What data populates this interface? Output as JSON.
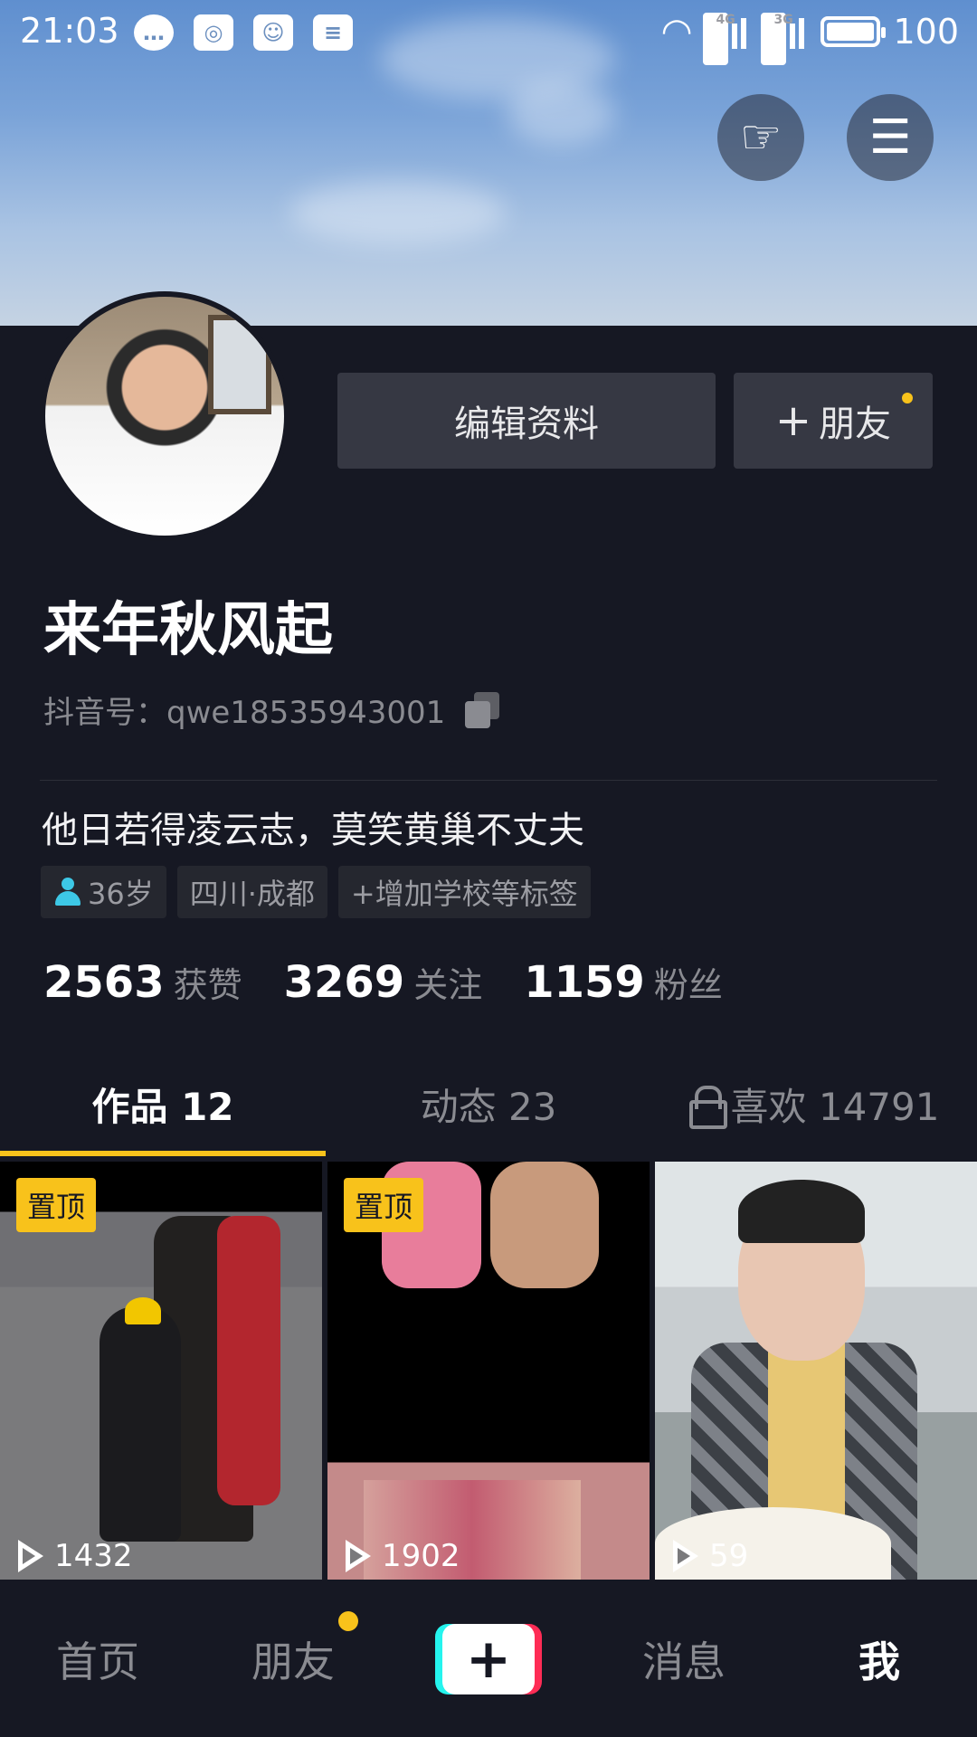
{
  "status_bar": {
    "time": "21:03",
    "battery_level": "100",
    "network_a": "4G",
    "network_b": "3G",
    "icons": [
      "message-icon",
      "weibo-icon",
      "qq-icon",
      "news-icon",
      "wifi-icon",
      "signal-icon",
      "battery-icon"
    ]
  },
  "header": {
    "icons": [
      "hand-pointer-icon",
      "menu-icon"
    ]
  },
  "profile": {
    "edit_label": "编辑资料",
    "add_friend_label": "朋友",
    "add_friend_plus": "+",
    "name": "来年秋风起",
    "uid_label": "抖音号：",
    "uid": "qwe18535943001",
    "bio": "他日若得凌云志，莫笑黄巢不丈夫",
    "tags": {
      "age": "36岁",
      "location": "四川·成都",
      "add_school": "+增加学校等标签"
    },
    "stats": [
      {
        "value": "2563",
        "label": "获赞"
      },
      {
        "value": "3269",
        "label": "关注"
      },
      {
        "value": "1159",
        "label": "粉丝"
      }
    ]
  },
  "tabs": [
    {
      "label": "作品 12"
    },
    {
      "label": "动态 23"
    },
    {
      "label": "喜欢 14791"
    }
  ],
  "videos": [
    {
      "pinned_label": "置顶",
      "plays": "1432"
    },
    {
      "pinned_label": "置顶",
      "plays": "1902"
    },
    {
      "plays": "59"
    }
  ],
  "nav": {
    "home": "首页",
    "friends": "朋友",
    "add": "+",
    "messages": "消息",
    "me": "我"
  },
  "colors": {
    "background": "#161823",
    "accent": "#f8c21b",
    "button_bg": "#363843",
    "muted_text": "#8a8b91",
    "cyan": "#25f4ee",
    "red": "#fe2c55"
  }
}
